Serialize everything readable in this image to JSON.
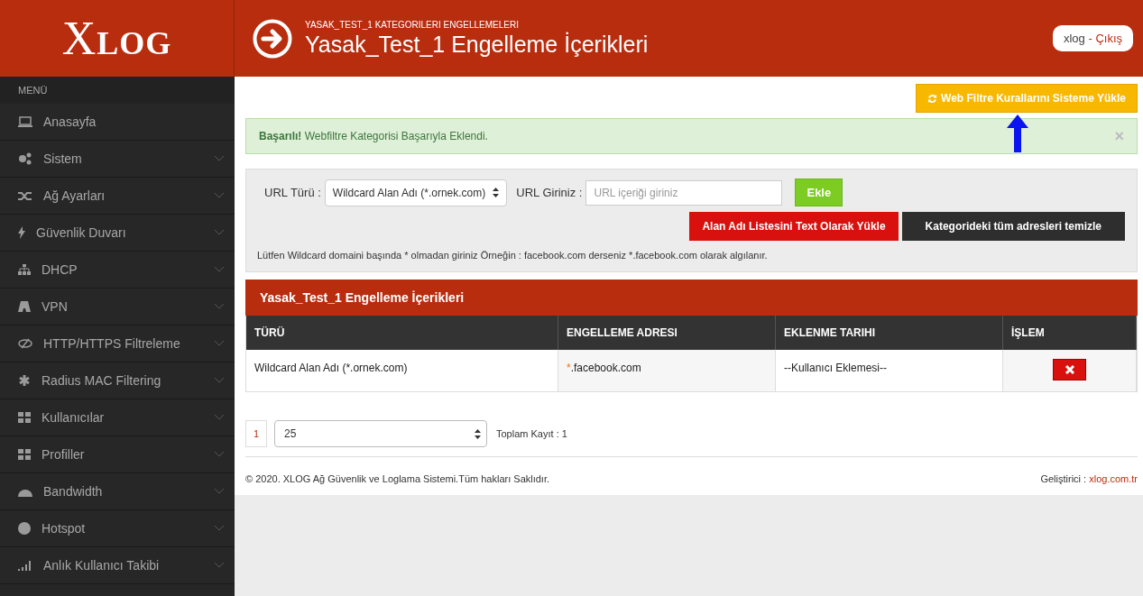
{
  "logo": "XLOG",
  "header": {
    "breadcrumb": "YASAK_TEST_1 KATEGORILERI ENGELLEMELERI",
    "title": "Yasak_Test_1 Engelleme İçerikleri",
    "user": "xlog",
    "separator": "-",
    "logout": "Çıkış"
  },
  "sidebar": {
    "heading": "MENÜ",
    "items": [
      {
        "label": "Anasayfa",
        "has_submenu": false
      },
      {
        "label": "Sistem",
        "has_submenu": true
      },
      {
        "label": "Ağ Ayarları",
        "has_submenu": true
      },
      {
        "label": "Güvenlik Duvarı",
        "has_submenu": true
      },
      {
        "label": "DHCP",
        "has_submenu": true
      },
      {
        "label": "VPN",
        "has_submenu": true
      },
      {
        "label": "HTTP/HTTPS Filtreleme",
        "has_submenu": true
      },
      {
        "label": "Radius MAC Filtering",
        "has_submenu": true
      },
      {
        "label": "Kullanıcılar",
        "has_submenu": true
      },
      {
        "label": "Profiller",
        "has_submenu": true
      },
      {
        "label": "Bandwidth",
        "has_submenu": true
      },
      {
        "label": "Hotspot",
        "has_submenu": true
      },
      {
        "label": "Anlık Kullanıcı Takibi",
        "has_submenu": true
      }
    ]
  },
  "load_rules_button": "Web Filtre Kurallarını Sisteme Yükle",
  "alert": {
    "text": "**Başarılı!** Webfiltre Kategorisi Başarıyla Eklendi.",
    "close": "×"
  },
  "form": {
    "url_type_label": "URL Türü :",
    "url_type_value": "Wildcard Alan Adı (*.ornek.com)",
    "url_label": "URL Giriniz :",
    "url_placeholder": "URL içeriği giriniz",
    "add_button": "Ekle",
    "upload_button": "Alan Adı Listesini Text Olarak Yükle",
    "clear_button": "Kategorideki tüm adresleri temizle",
    "hint": "Lütfen Wildcard domaini başında * olmadan giriniz Örneğin : facebook.com derseniz *.facebook.com olarak algılanır."
  },
  "table": {
    "title": "Yasak_Test_1 Engelleme İçerikleri",
    "columns": [
      "TÜRÜ",
      "ENGELLEME ADRESI",
      "EKLENME TARIHI",
      "İŞLEM"
    ],
    "rows": [
      {
        "type": "Wildcard Alan Adı (*.ornek.com)",
        "address": "*.facebook.com",
        "date": "--Kullanıcı Eklemesi--"
      }
    ]
  },
  "pagination": {
    "pages": [
      {
        "label": "1",
        "selected": true
      }
    ],
    "page_size": "25",
    "total": "Toplam Kayıt : 1"
  },
  "footer": {
    "copyright": "© 2020. XLOG Ağ Güvenlik ve Loglama Sistemi.Tüm hakları Saklıdır.",
    "developer_label": "Geliştirici :",
    "developer_link": "xlog.com.tr"
  }
}
